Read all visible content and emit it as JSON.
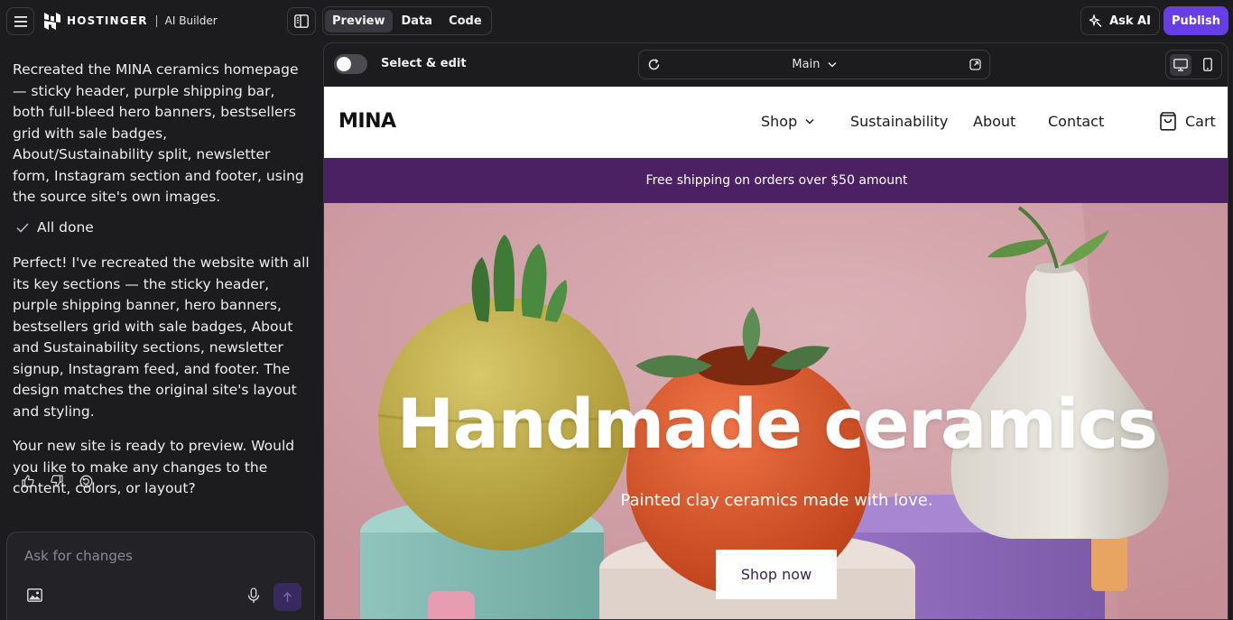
{
  "app": {
    "brand": "HOSTINGER",
    "product": "AI Builder",
    "tabs": [
      {
        "label": "Preview",
        "active": true
      },
      {
        "label": "Data",
        "active": false
      },
      {
        "label": "Code",
        "active": false
      }
    ],
    "ask_ai_label": "Ask AI",
    "publish_label": "Publish",
    "accent_color": "#673de6"
  },
  "chat": {
    "messages": [
      "Recreated the MINA ceramics homepage — sticky header, purple shipping bar, both full-bleed hero banners, bestsellers grid with sale badges, About/Sustainability split, newsletter form, Instagram section and footer, using the source site's own images.",
      "Perfect! I've recreated the website with all its key sections — the sticky header, purple shipping banner, hero banners, bestsellers grid with sale badges, About and Sustainability sections, newsletter signup, Instagram feed, and footer. The design matches the original site's layout and styling.",
      "Your new site is ready to preview. Would you like to make any changes to the content, colors, or layout?"
    ],
    "status": "All done",
    "input_placeholder": "Ask for changes",
    "icons": [
      "thumbs-up-icon",
      "thumbs-down-icon",
      "regenerate-icon",
      "image-icon",
      "microphone-icon",
      "send-arrow-icon"
    ]
  },
  "preview": {
    "select_edit_label": "Select & edit",
    "select_edit_enabled": false,
    "page_selector": "Main",
    "device": "desktop"
  },
  "site": {
    "brand": "MINA",
    "nav": {
      "shop": "Shop",
      "sustainability": "Sustainability",
      "about": "About",
      "contact": "Contact",
      "cart": "Cart"
    },
    "shipping_text": "Free shipping on orders over $50 amount",
    "shipping_bar_color": "#4b2163",
    "hero": {
      "title": "Handmade ceramics",
      "subtitle": "Painted clay ceramics made with love.",
      "cta": "Shop now"
    }
  }
}
